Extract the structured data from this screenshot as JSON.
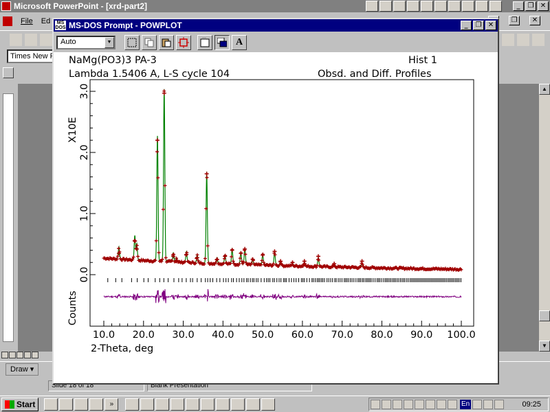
{
  "ppt": {
    "title": "Microsoft PowerPoint - [xrd-part2]",
    "menu": [
      "File",
      "Ed"
    ],
    "font_box": "Times New R",
    "draw_label": "Draw",
    "status_slide": "Slide 18 of 18",
    "status_template": "Blank Presentation",
    "win_min": "_",
    "win_restore": "❐",
    "win_close": "✕"
  },
  "dos": {
    "title": "MS-DOS Prompt - POWPLOT",
    "font_select": "Auto",
    "toolbar_bold": "A"
  },
  "plot": {
    "header_left_1": "NaMg(PO3)3 PA-3",
    "header_right_1": "Hist    1",
    "header_left_2": "Lambda 1.5406 A, L-S cycle  104",
    "header_right_2": "Obsd. and Diff. Profiles",
    "y_label_top": "X10E",
    "y_label_bottom": "Counts",
    "x_label": "2-Theta, deg",
    "x_tick_labels": [
      "10.0",
      "20.0",
      "30.0",
      "40.0",
      "50.0",
      "60.0",
      "70.0",
      "80.0",
      "90.0",
      "100.0"
    ],
    "y_tick_labels": [
      "0.0",
      "1.0",
      "2.0",
      "3.0"
    ]
  },
  "chart_data": {
    "type": "line",
    "title": "NaMg(PO3)3 PA-3",
    "subtitle": "Lambda 1.5406 A, L-S cycle  104",
    "xlabel": "2-Theta, deg",
    "ylabel": "Counts X10E",
    "xlim": [
      10,
      100
    ],
    "ylim": [
      -0.8,
      3.2
    ],
    "colors": {
      "observed": "#a00000",
      "calculated": "#008000",
      "difference": "#800080",
      "ticks": "#000000"
    },
    "background": 0.15,
    "peaks": [
      {
        "x": 13.8,
        "y": 0.35
      },
      {
        "x": 17.8,
        "y": 0.55
      },
      {
        "x": 18.3,
        "y": 0.42
      },
      {
        "x": 23.5,
        "y": 2.2
      },
      {
        "x": 25.2,
        "y": 2.97
      },
      {
        "x": 27.5,
        "y": 0.3
      },
      {
        "x": 28.3,
        "y": 0.22
      },
      {
        "x": 30.8,
        "y": 0.33
      },
      {
        "x": 33.5,
        "y": 0.28
      },
      {
        "x": 35.9,
        "y": 1.65
      },
      {
        "x": 38.5,
        "y": 0.25
      },
      {
        "x": 40.5,
        "y": 0.3
      },
      {
        "x": 42.3,
        "y": 0.4
      },
      {
        "x": 44.5,
        "y": 0.35
      },
      {
        "x": 45.5,
        "y": 0.42
      },
      {
        "x": 47.5,
        "y": 0.25
      },
      {
        "x": 50.0,
        "y": 0.32
      },
      {
        "x": 53.0,
        "y": 0.38
      },
      {
        "x": 54.5,
        "y": 0.22
      },
      {
        "x": 57.5,
        "y": 0.2
      },
      {
        "x": 60.5,
        "y": 0.22
      },
      {
        "x": 64.0,
        "y": 0.3
      },
      {
        "x": 68.0,
        "y": 0.18
      },
      {
        "x": 75.0,
        "y": 0.22
      }
    ],
    "difference_offset": -0.36,
    "reflection_tick_level": -0.09,
    "reflection_range": [
      11,
      100
    ]
  },
  "taskbar": {
    "start": "Start",
    "clock": "09:25",
    "lang": "En",
    "more": "»"
  }
}
